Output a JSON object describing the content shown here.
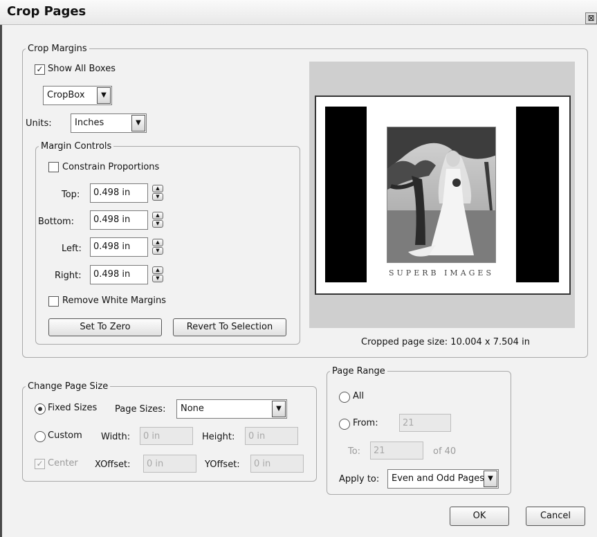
{
  "window": {
    "title": "Crop Pages",
    "close_glyph": "⊠"
  },
  "crop_margins": {
    "legend": "Crop Margins",
    "show_all_boxes": {
      "label": "Show All Boxes",
      "checked": true
    },
    "box_select": {
      "value": "CropBox"
    },
    "units": {
      "label": "Units:",
      "value": "Inches"
    },
    "margin_controls": {
      "legend": "Margin Controls",
      "constrain_proportions": {
        "label": "Constrain Proportions",
        "checked": false
      },
      "top": {
        "label": "Top:",
        "value": "0.498 in"
      },
      "bottom": {
        "label": "Bottom:",
        "value": "0.498 in"
      },
      "left": {
        "label": "Left:",
        "value": "0.498 in"
      },
      "right": {
        "label": "Right:",
        "value": "0.498 in"
      },
      "remove_white_margins": {
        "label": "Remove White Margins",
        "checked": false
      },
      "set_to_zero": "Set To Zero",
      "revert_to_selection": "Revert To Selection"
    },
    "preview": {
      "caption": "SUPERB IMAGES",
      "cropped_size": "Cropped page size: 10.004 x 7.504 in"
    }
  },
  "change_page_size": {
    "legend": "Change Page Size",
    "fixed_sizes": {
      "label": "Fixed Sizes",
      "selected": true
    },
    "page_sizes": {
      "label": "Page Sizes:",
      "value": "None"
    },
    "custom": {
      "label": "Custom",
      "selected": false
    },
    "width": {
      "label": "Width:",
      "value": "0 in"
    },
    "height": {
      "label": "Height:",
      "value": "0 in"
    },
    "center": {
      "label": "Center",
      "checked": true
    },
    "xoffset": {
      "label": "XOffset:",
      "value": "0 in"
    },
    "yoffset": {
      "label": "YOffset:",
      "value": "0 in"
    }
  },
  "page_range": {
    "legend": "Page Range",
    "all": {
      "label": "All",
      "selected": false
    },
    "from": {
      "label": "From:",
      "value": "21",
      "selected": false
    },
    "to": {
      "label": "To:",
      "value": "21"
    },
    "of_total": "of 40",
    "apply_to": {
      "label": "Apply to:",
      "value": "Even and Odd Pages"
    }
  },
  "buttons": {
    "ok": "OK",
    "cancel": "Cancel"
  },
  "icons": {
    "check": "✓",
    "dropdown": "▼",
    "spin_up": "▲",
    "spin_down": "▼"
  }
}
